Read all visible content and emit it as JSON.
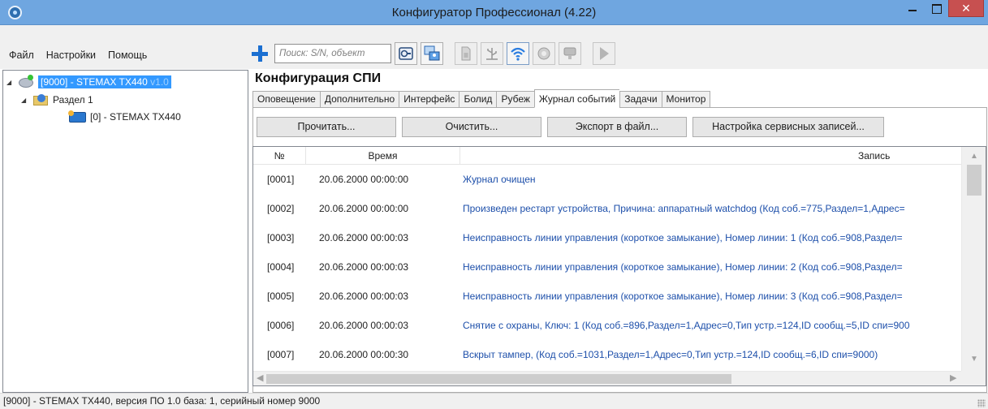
{
  "window": {
    "title": "Конфигуратор Профессионал (4.22)",
    "close_glyph": "✕"
  },
  "menu": {
    "items": [
      {
        "label": "Файл"
      },
      {
        "label": "Настройки"
      },
      {
        "label": "Помощь"
      }
    ]
  },
  "toolbar": {
    "search_placeholder": "Поиск: S/N, объект",
    "icons": [
      "add-icon",
      "find-device-icon",
      "connect-users-icon",
      "sim-card-icon",
      "usb-icon",
      "wifi-icon",
      "ethernet-icon",
      "gsm-icon",
      "play-icon"
    ]
  },
  "tree": {
    "items": [
      {
        "label": "[9000] - STEMAX TX440",
        "version": " v1.0",
        "selected": true
      },
      {
        "label": "Раздел 1"
      },
      {
        "label": "[0] - STEMAX TX440"
      }
    ]
  },
  "main": {
    "section_title": "Конфигурация СПИ",
    "tabs": [
      {
        "label": "Оповещение"
      },
      {
        "label": "Дополнительно"
      },
      {
        "label": "Интерфейс"
      },
      {
        "label": "Болид"
      },
      {
        "label": "Рубеж"
      },
      {
        "label": "Журнал событий",
        "active": true
      },
      {
        "label": "Задачи"
      },
      {
        "label": "Монитор"
      }
    ],
    "buttons": {
      "read": "Прочитать...",
      "clear": "Очистить...",
      "export": "Экспорт в файл...",
      "service": "Настройка сервисных записей..."
    },
    "table": {
      "columns": [
        "№",
        "Время",
        "Запись"
      ],
      "rows": [
        {
          "num": "[0001]",
          "time": "20.06.2000 00:00:00",
          "record": "Журнал очищен"
        },
        {
          "num": "[0002]",
          "time": "20.06.2000 00:00:00",
          "record": "Произведен рестарт устройства, Причина: аппаратный watchdog (Код соб.=775,Раздел=1,Адрес="
        },
        {
          "num": "[0003]",
          "time": "20.06.2000 00:00:03",
          "record": "Неисправность линии управления (короткое замыкание), Номер линии: 1 (Код соб.=908,Раздел="
        },
        {
          "num": "[0004]",
          "time": "20.06.2000 00:00:03",
          "record": "Неисправность линии управления (короткое замыкание), Номер линии: 2 (Код соб.=908,Раздел="
        },
        {
          "num": "[0005]",
          "time": "20.06.2000 00:00:03",
          "record": "Неисправность линии управления (короткое замыкание), Номер линии: 3 (Код соб.=908,Раздел="
        },
        {
          "num": "[0006]",
          "time": "20.06.2000 00:00:03",
          "record": "Снятие с охраны, Ключ: 1 (Код соб.=896,Раздел=1,Адрес=0,Тип устр.=124,ID сообщ.=5,ID спи=900"
        },
        {
          "num": "[0007]",
          "time": "20.06.2000 00:00:30",
          "record": "Вскрыт тампер,  (Код соб.=1031,Раздел=1,Адрес=0,Тип устр.=124,ID сообщ.=6,ID спи=9000)"
        }
      ]
    }
  },
  "status": {
    "text": "[9000] - STEMAX TX440, версия ПО 1.0 база: 1, серийный номер 9000"
  },
  "colors": {
    "titlebar": "#6fa6e0",
    "selection": "#3399ff",
    "record_text": "#1d4faa",
    "close_button": "#c75050"
  }
}
